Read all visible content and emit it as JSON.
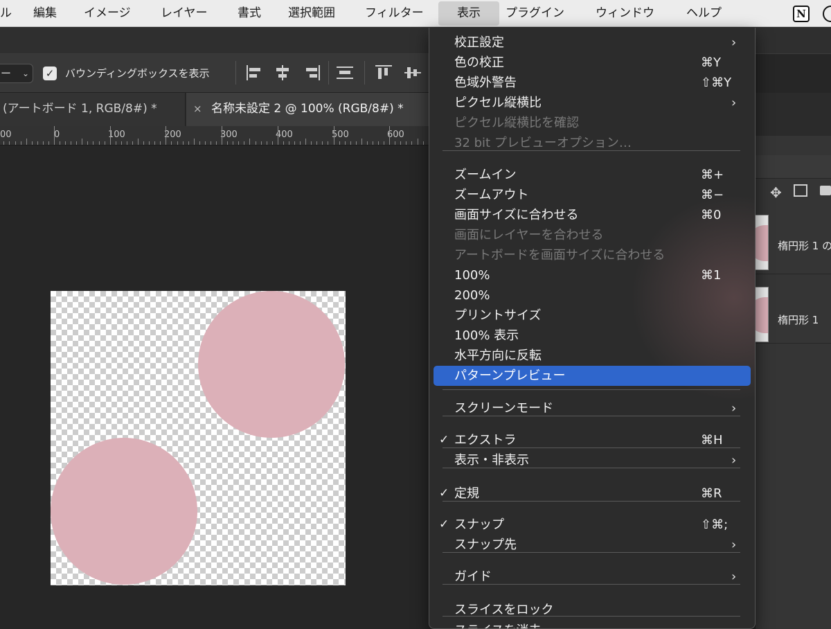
{
  "menubar": {
    "items": [
      "ル",
      "編集",
      "イメージ",
      "レイヤー",
      "書式",
      "選択範囲",
      "フィルター",
      "表示",
      "プラグイン",
      "ウィンドウ",
      "ヘルプ"
    ],
    "active": "表示",
    "status_icon_letter": "N"
  },
  "options": {
    "select_value": "ー",
    "bbox_checked": true,
    "bbox_label": "バウンディングボックスを表示",
    "checkmark": "✓"
  },
  "tabs": [
    {
      "label": "(アートボード 1, RGB/8#) *"
    },
    {
      "close": "×",
      "label": "名称未設定 2 @ 100% (RGB/8#) *"
    }
  ],
  "ruler": {
    "labels": [
      "00",
      "0",
      "100",
      "200",
      "300",
      "400",
      "500",
      "600"
    ]
  },
  "layers": [
    {
      "name": "楕円形 1 の"
    },
    {
      "name": "楕円形 1"
    }
  ],
  "canvas": {
    "circle_color": "#dcb0b8"
  },
  "view_menu": {
    "items": [
      {
        "label": "校正設定",
        "submenu": true
      },
      {
        "label": "色の校正",
        "shortcut": "⌘Y"
      },
      {
        "label": "色域外警告",
        "shortcut": "⇧⌘Y"
      },
      {
        "label": "ピクセル縦横比",
        "submenu": true
      },
      {
        "label": "ピクセル縦横比を確認",
        "disabled": true
      },
      {
        "label": "32 bit プレビューオプション…",
        "disabled": true
      },
      {
        "label": "ズームイン",
        "shortcut": "⌘+"
      },
      {
        "label": "ズームアウト",
        "shortcut": "⌘−"
      },
      {
        "label": "画面サイズに合わせる",
        "shortcut": "⌘0"
      },
      {
        "label": "画面にレイヤーを合わせる",
        "disabled": true
      },
      {
        "label": "アートボードを画面サイズに合わせる",
        "disabled": true
      },
      {
        "label": "100%",
        "shortcut": "⌘1"
      },
      {
        "label": "200%"
      },
      {
        "label": "プリントサイズ"
      },
      {
        "label": "100% 表示"
      },
      {
        "label": "水平方向に反転"
      },
      {
        "label": "パターンプレビュー",
        "highlighted": true
      },
      {
        "label": "スクリーンモード",
        "submenu": true
      },
      {
        "label": "エクストラ",
        "shortcut": "⌘H",
        "checked": true
      },
      {
        "label": "表示・非表示",
        "submenu": true
      },
      {
        "label": "定規",
        "shortcut": "⌘R",
        "checked": true
      },
      {
        "label": "スナップ",
        "shortcut": "⇧⌘;",
        "checked": true
      },
      {
        "label": "スナップ先",
        "submenu": true
      },
      {
        "label": "ガイド",
        "submenu": true
      },
      {
        "label": "スライスをロック"
      },
      {
        "label": "スライスを消去"
      }
    ],
    "check_glyph": "✓",
    "arrow_glyph": "›"
  }
}
